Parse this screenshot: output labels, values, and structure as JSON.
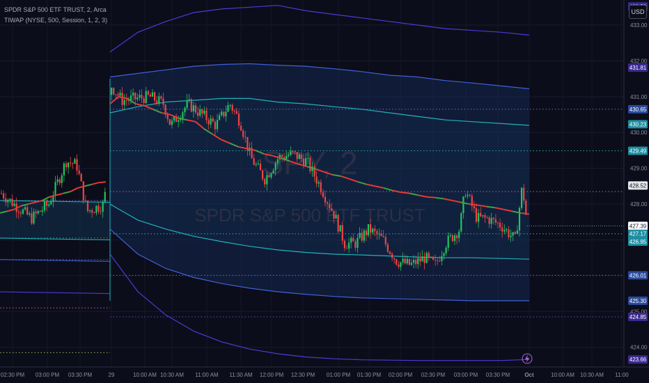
{
  "header": {
    "symbol_line": "SPDR S&P 500 ETF TRUST, 2, Arca",
    "indicator_line": "TIWAP (NYSE, 500, Session, 1, 2, 3)"
  },
  "currency_label": "USD",
  "watermark": {
    "ticker": "SPY, 2",
    "name": "SPDR S&P 500 ETF TRUST"
  },
  "event_icon": "lightning-icon",
  "chart_data": {
    "type": "candlestick",
    "y_axis": {
      "range": [
        423.45,
        433.7
      ],
      "ticks": [
        "433.00",
        "432.00",
        "431.00",
        "430.00",
        "429.00",
        "428.00",
        "427.00",
        "426.00",
        "425.00",
        "424.00"
      ]
    },
    "x_axis": {
      "ticks": [
        "02:30 PM",
        "03:00 PM",
        "03:30 PM",
        "29",
        "10:00 AM",
        "10:30 AM",
        "11:00 AM",
        "11:30 AM",
        "12:00 PM",
        "12:30 PM",
        "01:00 PM",
        "01:30 PM",
        "02:00 PM",
        "02:30 PM",
        "03:00 PM",
        "03:30 PM",
        "Oct",
        "10:00 AM",
        "10:30 AM",
        "11:00"
      ]
    },
    "price_badges": [
      {
        "value": "433.52",
        "bg": "#3b2a8f",
        "fg": "#ffffff"
      },
      {
        "value": "431.81",
        "bg": "#3b2a8f",
        "fg": "#ffffff"
      },
      {
        "value": "430.65",
        "bg": "#2a4a9c",
        "fg": "#ffffff"
      },
      {
        "value": "430.23",
        "bg": "#1e8ea0",
        "fg": "#ffffff"
      },
      {
        "value": "429.49",
        "bg": "#1e8ea0",
        "fg": "#ffffff"
      },
      {
        "value": "428.52",
        "bg": "#e6e6ea",
        "fg": "#131722"
      },
      {
        "value": "427.39",
        "bg": "#ffffff",
        "fg": "#131722"
      },
      {
        "value": "427.17",
        "bg": "#1e8ea0",
        "fg": "#ffffff"
      },
      {
        "value": "426.95",
        "bg": "#1e8ea0",
        "fg": "#ffffff"
      },
      {
        "value": "426.01",
        "bg": "#2a4a9c",
        "fg": "#ffffff"
      },
      {
        "value": "425.30",
        "bg": "#2a4a9c",
        "fg": "#ffffff"
      },
      {
        "value": "424.85",
        "bg": "#3b2a8f",
        "fg": "#ffffff"
      },
      {
        "value": "423.66",
        "bg": "#3b2a8f",
        "fg": "#ffffff"
      }
    ],
    "dotted_levels": [
      {
        "y": 430.65,
        "color": "#5b6fd6"
      },
      {
        "y": 429.49,
        "color": "#21b3b8"
      },
      {
        "y": 428.35,
        "color": "#d14fc6"
      },
      {
        "y": 427.17,
        "color": "#21b3b8"
      },
      {
        "y": 426.01,
        "color": "#5b6fd6"
      },
      {
        "y": 424.85,
        "color": "#6b3fd6"
      }
    ],
    "prev_session_levels": [
      {
        "y": 428.1,
        "color": "#5b6fd6"
      },
      {
        "y": 427.05,
        "color": "#21b3b8"
      },
      {
        "y": 426.45,
        "color": "#5b6fd6"
      },
      {
        "y": 425.1,
        "color": "#d14fc6"
      },
      {
        "y": 423.85,
        "color": "#8bbf4a"
      }
    ],
    "vwap": {
      "x": [
        0,
        0.25,
        0.5,
        0.75,
        1.0,
        1.25,
        1.5,
        1.75,
        2.0,
        2.25,
        2.5,
        2.75,
        3.0,
        3.25,
        3.5,
        3.75,
        4.0,
        4.25,
        4.5,
        4.75,
        5.0,
        5.25,
        5.5,
        5.75,
        6.0,
        6.25,
        6.5,
        6.75,
        7.0,
        7.25,
        7.5,
        7.75,
        8.0,
        8.25,
        8.5,
        8.75,
        9.0,
        9.25,
        9.5,
        9.75,
        10.0,
        10.25,
        10.5,
        10.75,
        11.0,
        11.25,
        11.5,
        11.75,
        12.0,
        12.25,
        12.5,
        12.75,
        13.0,
        13.25,
        13.5,
        13.75,
        14.0,
        14.25,
        14.5,
        14.75,
        15.0,
        15.25,
        15.5,
        15.75,
        16.0,
        16.25
      ],
      "y": [
        427.75,
        427.8,
        427.85,
        427.95,
        428.0,
        428.05,
        428.1,
        428.2,
        428.25,
        428.3,
        428.35,
        428.45,
        428.5,
        428.55,
        428.6,
        428.62,
        430.8,
        431.0,
        430.95,
        430.8,
        430.75,
        430.65,
        430.55,
        430.5,
        430.4,
        430.35,
        430.3,
        430.1,
        429.95,
        429.8,
        429.7,
        429.6,
        429.55,
        429.5,
        429.4,
        429.35,
        429.28,
        429.2,
        429.12,
        429.05,
        428.98,
        428.9,
        428.82,
        428.78,
        428.7,
        428.62,
        428.55,
        428.5,
        428.45,
        428.38,
        428.33,
        428.3,
        428.25,
        428.2,
        428.18,
        428.15,
        428.1,
        428.05,
        428.0,
        427.97,
        427.93,
        427.9,
        427.85,
        427.8,
        427.75,
        427.72
      ]
    },
    "bands": [
      {
        "name": "upper3",
        "y": [
          432.25,
          432.8,
          433.1,
          433.35,
          433.45,
          433.5,
          433.55,
          433.4,
          433.3,
          433.2,
          433.1,
          433.0,
          432.9,
          432.85,
          432.8,
          432.72
        ]
      },
      {
        "name": "upper2",
        "y": [
          431.55,
          431.65,
          431.75,
          431.85,
          431.9,
          431.92,
          431.88,
          431.85,
          431.78,
          431.7,
          431.6,
          431.55,
          431.45,
          431.38,
          431.3,
          431.22
        ]
      },
      {
        "name": "upper1",
        "y": [
          430.55,
          430.72,
          430.85,
          430.9,
          430.95,
          430.95,
          430.85,
          430.8,
          430.72,
          430.65,
          430.55,
          430.45,
          430.35,
          430.3,
          430.25,
          430.2
        ]
      },
      {
        "name": "lower1",
        "y": [
          428.0,
          427.55,
          427.3,
          427.1,
          426.95,
          426.82,
          426.72,
          426.65,
          426.6,
          426.58,
          426.55,
          426.52,
          426.5,
          426.5,
          426.48,
          426.46
        ]
      },
      {
        "name": "lower2",
        "y": [
          427.3,
          426.6,
          426.2,
          425.95,
          425.78,
          425.65,
          425.55,
          425.48,
          425.42,
          425.38,
          425.36,
          425.34,
          425.32,
          425.3,
          425.3,
          425.3
        ]
      },
      {
        "name": "lower3",
        "y": [
          426.6,
          425.55,
          424.9,
          424.45,
          424.15,
          423.95,
          423.82,
          423.73,
          423.68,
          423.65,
          423.64,
          423.63,
          423.63,
          423.63,
          423.63,
          423.66
        ]
      }
    ],
    "candles_summary": {
      "prev_session_close": 427.9,
      "day_open": 431.05,
      "day_high": 431.65,
      "day_low": 425.95,
      "last": 427.39,
      "last_high": 428.52
    }
  },
  "colors": {
    "background": "#0c0d1a",
    "up": "#22c55e",
    "down": "#ef4444",
    "band_cyan": "#21b3b8",
    "band_blue": "#3f62d8",
    "band_purple": "#4d3ad8",
    "vwap_red": "#e53935",
    "vwap_green": "#43a047"
  }
}
